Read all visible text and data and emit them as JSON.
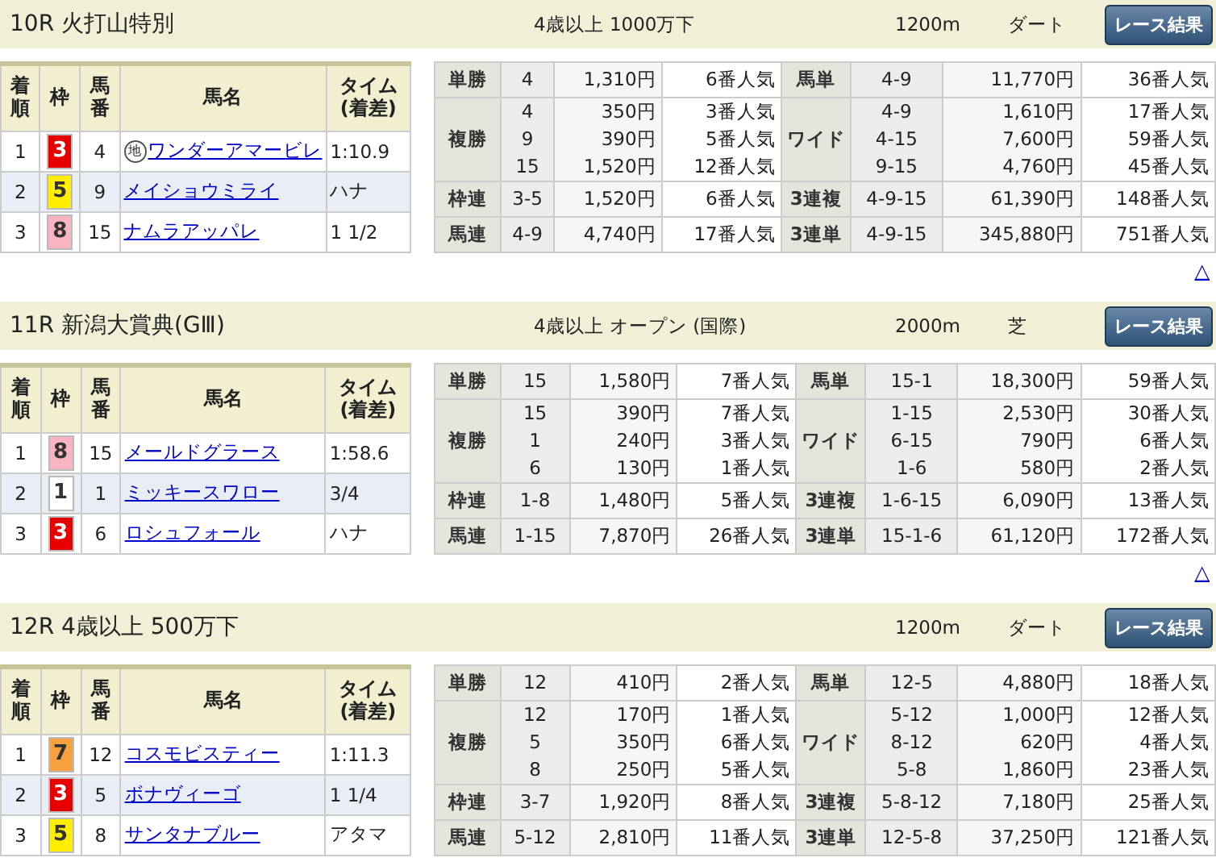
{
  "races": [
    {
      "title": "10R 火打山特別",
      "conditions": "4歳以上 1000万下",
      "distance": "1200m",
      "surface": "ダート",
      "button": "レース結果",
      "columns": [
        "着順",
        "枠",
        "馬番",
        "馬名",
        "タイム\n(着差)"
      ],
      "results": [
        {
          "rank": "1",
          "frame": "3",
          "color": "#e60000",
          "number": "4",
          "badge": "地",
          "name": "ワンダーアマービレ",
          "time": "1:10.9"
        },
        {
          "rank": "2",
          "frame": "5",
          "color": "#ffee00",
          "number": "9",
          "name": "メイショウミライ",
          "time": "ハナ"
        },
        {
          "rank": "3",
          "frame": "8",
          "color": "#f8b4c0",
          "number": "15",
          "name": "ナムラアッパレ",
          "time": "1 1/2"
        }
      ],
      "payouts": [
        {
          "left": {
            "label": "単勝",
            "lines": [
              [
                "4",
                "1,310円",
                "6番人気"
              ]
            ]
          },
          "right": {
            "label": "馬単",
            "lines": [
              [
                "4-9",
                "11,770円",
                "36番人気"
              ]
            ]
          }
        },
        {
          "left": {
            "label": "複勝",
            "lines": [
              [
                "4",
                "350円",
                "3番人気"
              ],
              [
                "9",
                "390円",
                "5番人気"
              ],
              [
                "15",
                "1,520円",
                "12番人気"
              ]
            ]
          },
          "right": {
            "label": "ワイド",
            "lines": [
              [
                "4-9",
                "1,610円",
                "17番人気"
              ],
              [
                "4-15",
                "7,600円",
                "59番人気"
              ],
              [
                "9-15",
                "4,760円",
                "45番人気"
              ]
            ]
          }
        },
        {
          "left": {
            "label": "枠連",
            "lines": [
              [
                "3-5",
                "1,520円",
                "6番人気"
              ]
            ]
          },
          "right": {
            "label": "3連複",
            "lines": [
              [
                "4-9-15",
                "61,390円",
                "148番人気"
              ]
            ]
          }
        },
        {
          "left": {
            "label": "馬連",
            "lines": [
              [
                "4-9",
                "4,740円",
                "17番人気"
              ]
            ]
          },
          "right": {
            "label": "3連単",
            "lines": [
              [
                "4-9-15",
                "345,880円",
                "751番人気"
              ]
            ]
          }
        }
      ],
      "top_link": "△"
    },
    {
      "title": "11R 新潟大賞典(GⅢ)",
      "conditions": "4歳以上 オープン (国際)",
      "distance": "2000m",
      "surface": "芝",
      "button": "レース結果",
      "columns": [
        "着順",
        "枠",
        "馬番",
        "馬名",
        "タイム\n(着差)"
      ],
      "results": [
        {
          "rank": "1",
          "frame": "8",
          "color": "#f8b4c0",
          "number": "15",
          "name": "メールドグラース",
          "time": "1:58.6"
        },
        {
          "rank": "2",
          "frame": "1",
          "color": "#ffffff",
          "number": "1",
          "name": "ミッキースワロー",
          "time": "3/4"
        },
        {
          "rank": "3",
          "frame": "3",
          "color": "#e60000",
          "number": "6",
          "name": "ロシュフォール",
          "time": "ハナ"
        }
      ],
      "payouts": [
        {
          "left": {
            "label": "単勝",
            "lines": [
              [
                "15",
                "1,580円",
                "7番人気"
              ]
            ]
          },
          "right": {
            "label": "馬単",
            "lines": [
              [
                "15-1",
                "18,300円",
                "59番人気"
              ]
            ]
          }
        },
        {
          "left": {
            "label": "複勝",
            "lines": [
              [
                "15",
                "390円",
                "7番人気"
              ],
              [
                "1",
                "240円",
                "3番人気"
              ],
              [
                "6",
                "130円",
                "1番人気"
              ]
            ]
          },
          "right": {
            "label": "ワイド",
            "lines": [
              [
                "1-15",
                "2,530円",
                "30番人気"
              ],
              [
                "6-15",
                "790円",
                "6番人気"
              ],
              [
                "1-6",
                "580円",
                "2番人気"
              ]
            ]
          }
        },
        {
          "left": {
            "label": "枠連",
            "lines": [
              [
                "1-8",
                "1,480円",
                "5番人気"
              ]
            ]
          },
          "right": {
            "label": "3連複",
            "lines": [
              [
                "1-6-15",
                "6,090円",
                "13番人気"
              ]
            ]
          }
        },
        {
          "left": {
            "label": "馬連",
            "lines": [
              [
                "1-15",
                "7,870円",
                "26番人気"
              ]
            ]
          },
          "right": {
            "label": "3連単",
            "lines": [
              [
                "15-1-6",
                "61,120円",
                "172番人気"
              ]
            ]
          }
        }
      ],
      "top_link": "△"
    },
    {
      "title": "12R 4歳以上 500万下",
      "distance": "1200m",
      "surface": "ダート",
      "button": "レース結果",
      "columns": [
        "着順",
        "枠",
        "馬番",
        "馬名",
        "タイム\n(着差)"
      ],
      "results": [
        {
          "rank": "1",
          "frame": "7",
          "color": "#f7a040",
          "number": "12",
          "name": "コスモビスティー",
          "time": "1:11.3"
        },
        {
          "rank": "2",
          "frame": "3",
          "color": "#e60000",
          "number": "5",
          "name": "ボナヴィーゴ",
          "time": "1 1/4"
        },
        {
          "rank": "3",
          "frame": "5",
          "color": "#ffee00",
          "number": "8",
          "name": "サンタナブルー",
          "time": "アタマ"
        }
      ],
      "payouts": [
        {
          "left": {
            "label": "単勝",
            "lines": [
              [
                "12",
                "410円",
                "2番人気"
              ]
            ]
          },
          "right": {
            "label": "馬単",
            "lines": [
              [
                "12-5",
                "4,880円",
                "18番人気"
              ]
            ]
          }
        },
        {
          "left": {
            "label": "複勝",
            "lines": [
              [
                "12",
                "170円",
                "1番人気"
              ],
              [
                "5",
                "350円",
                "6番人気"
              ],
              [
                "8",
                "250円",
                "5番人気"
              ]
            ]
          },
          "right": {
            "label": "ワイド",
            "lines": [
              [
                "5-12",
                "1,000円",
                "12番人気"
              ],
              [
                "8-12",
                "620円",
                "4番人気"
              ],
              [
                "5-8",
                "1,860円",
                "23番人気"
              ]
            ]
          }
        },
        {
          "left": {
            "label": "枠連",
            "lines": [
              [
                "3-7",
                "1,920円",
                "8番人気"
              ]
            ]
          },
          "right": {
            "label": "3連複",
            "lines": [
              [
                "5-8-12",
                "7,180円",
                "25番人気"
              ]
            ]
          }
        },
        {
          "left": {
            "label": "馬連",
            "lines": [
              [
                "5-12",
                "2,810円",
                "11番人気"
              ]
            ]
          },
          "right": {
            "label": "3連単",
            "lines": [
              [
                "12-5-8",
                "37,250円",
                "121番人気"
              ]
            ]
          }
        }
      ]
    }
  ]
}
